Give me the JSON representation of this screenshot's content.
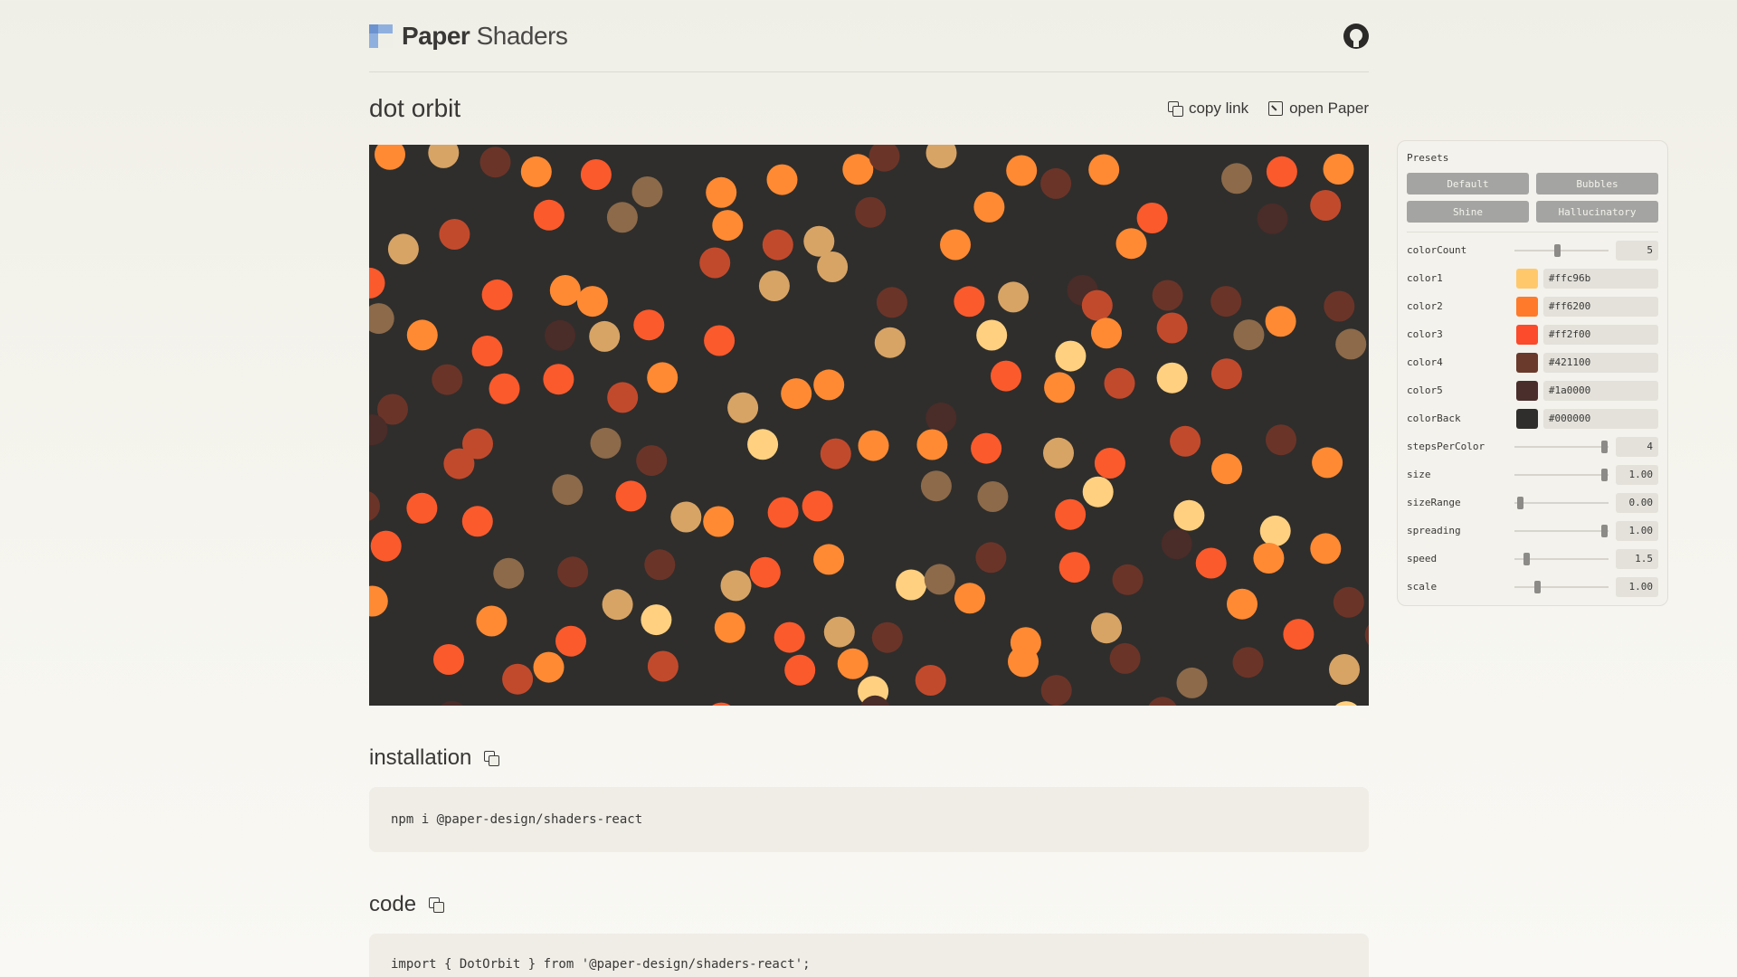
{
  "header": {
    "brand_bold": "Paper",
    "brand_light": "Shaders"
  },
  "titlebar": {
    "title": "dot orbit",
    "copy_link_label": "copy link",
    "open_paper_label": "open Paper"
  },
  "installation": {
    "heading": "installation",
    "code": "npm i @paper-design/shaders-react"
  },
  "code": {
    "heading": "code",
    "code": "import { DotOrbit } from '@paper-design/shaders-react';"
  },
  "panel": {
    "presets_label": "Presets",
    "presets": [
      "Default",
      "Bubbles",
      "Shine",
      "Hallucinatory"
    ],
    "controls": [
      {
        "name": "colorCount",
        "type": "slider",
        "value": "5",
        "fraction": 0.44
      },
      {
        "name": "color1",
        "type": "color",
        "value": "#ffc96b",
        "swatch": "#ffc96b"
      },
      {
        "name": "color2",
        "type": "color",
        "value": "#ff6200",
        "swatch": "#ff7a2a"
      },
      {
        "name": "color3",
        "type": "color",
        "value": "#ff2f00",
        "swatch": "#fb4a2c"
      },
      {
        "name": "color4",
        "type": "color",
        "value": "#421100",
        "swatch": "#6a3a2c"
      },
      {
        "name": "color5",
        "type": "color",
        "value": "#1a0000",
        "swatch": "#4a2e2c"
      },
      {
        "name": "colorBack",
        "type": "color",
        "value": "#000000",
        "swatch": "#2f2e2c"
      },
      {
        "name": "stepsPerColor",
        "type": "slider",
        "value": "4",
        "fraction": 0.97
      },
      {
        "name": "size",
        "type": "slider",
        "value": "1.00",
        "fraction": 0.97
      },
      {
        "name": "sizeRange",
        "type": "slider",
        "value": "0.00",
        "fraction": 0.03
      },
      {
        "name": "spreading",
        "type": "slider",
        "value": "1.00",
        "fraction": 0.97
      },
      {
        "name": "speed",
        "type": "slider",
        "value": "1.5",
        "fraction": 0.1
      },
      {
        "name": "scale",
        "type": "slider",
        "value": "1.00",
        "fraction": 0.22
      }
    ]
  },
  "colors": {
    "canvas_bg": "#2f2e2c",
    "dots": [
      "#ffd080",
      "#ff8a33",
      "#fb5a2c",
      "#c24a2c",
      "#6b3428",
      "#4a2c28",
      "#d7a466",
      "#8c6a4a"
    ]
  }
}
